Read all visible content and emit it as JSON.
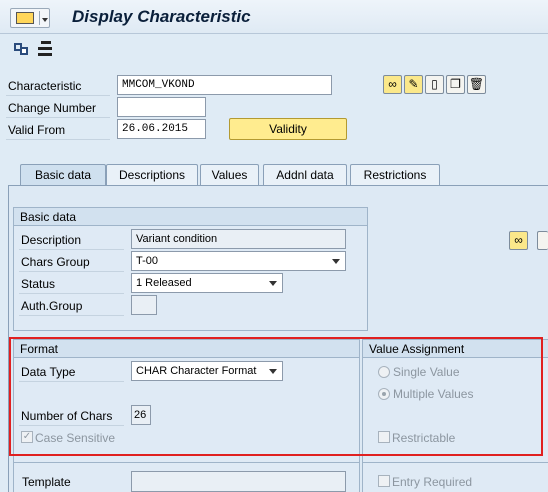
{
  "window": {
    "title": "Display Characteristic"
  },
  "toolbar": {
    "icons": [
      "switch-display-icon",
      "hierarchy-icon"
    ]
  },
  "header": {
    "characteristic": {
      "label": "Characteristic",
      "value": "MMCOM_VKOND"
    },
    "change_number": {
      "label": "Change Number",
      "value": ""
    },
    "valid_from": {
      "label": "Valid From",
      "value": "26.06.2015"
    },
    "validity_button": "Validity",
    "side_buttons": [
      "glasses-icon",
      "pencil-icon",
      "new-document-icon",
      "copy-icon",
      "trash-icon"
    ]
  },
  "tabs": [
    {
      "label": "Basic data"
    },
    {
      "label": "Descriptions"
    },
    {
      "label": "Values"
    },
    {
      "label": "Addnl data"
    },
    {
      "label": "Restrictions"
    }
  ],
  "basic_data": {
    "title": "Basic data",
    "description": {
      "label": "Description",
      "value": "Variant condition"
    },
    "chars_group": {
      "label": "Chars Group",
      "value": "T-00"
    },
    "status": {
      "label": "Status",
      "value": "1 Released"
    },
    "auth_group": {
      "label": "Auth.Group",
      "value": ""
    }
  },
  "format": {
    "title": "Format",
    "data_type": {
      "label": "Data Type",
      "value": "CHAR Character Format"
    },
    "number_of_chars": {
      "label": "Number of Chars",
      "value": "26"
    },
    "case_sensitive": {
      "label": "Case Sensitive",
      "checked": true
    }
  },
  "value_assignment": {
    "title": "Value Assignment",
    "single_value": "Single Value",
    "multiple_values": "Multiple Values",
    "selected": "multiple_values",
    "restrictable": "Restrictable",
    "entry_required": "Entry Required"
  },
  "template": {
    "label": "Template",
    "value": ""
  },
  "colors": {
    "highlight": "#e02020",
    "validity_button": "#ffec8f"
  }
}
